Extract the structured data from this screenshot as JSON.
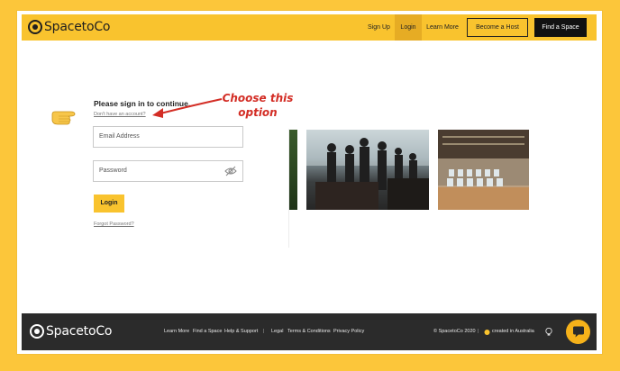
{
  "header": {
    "brand": "SpacetoCo",
    "nav": [
      {
        "label": "Sign Up",
        "active": false
      },
      {
        "label": "Login",
        "active": true
      },
      {
        "label": "Learn More",
        "active": false
      }
    ],
    "host_button": "Become a Host",
    "space_button": "Find a Space"
  },
  "signin": {
    "title": "Please sign in to continue.",
    "no_account_link": "Don't have an account?",
    "email_placeholder": "Email Address",
    "password_placeholder": "Password",
    "login_button": "Login",
    "forgot_link": "Forgot Password?"
  },
  "annotation": {
    "line1": "Choose this",
    "line2": "option"
  },
  "footer": {
    "brand": "SpacetoCo",
    "links": [
      "Learn More",
      "Find a Space",
      "Help & Support",
      "|",
      "Legal",
      "Terms & Conditions",
      "Privacy Policy"
    ],
    "copyright": "© SpacetoCo 2020",
    "separator": "|",
    "created": "created in Australia"
  },
  "colors": {
    "accent": "#f9c32e",
    "annotation": "#d32d25",
    "footer_bg": "#2b2b2b"
  }
}
